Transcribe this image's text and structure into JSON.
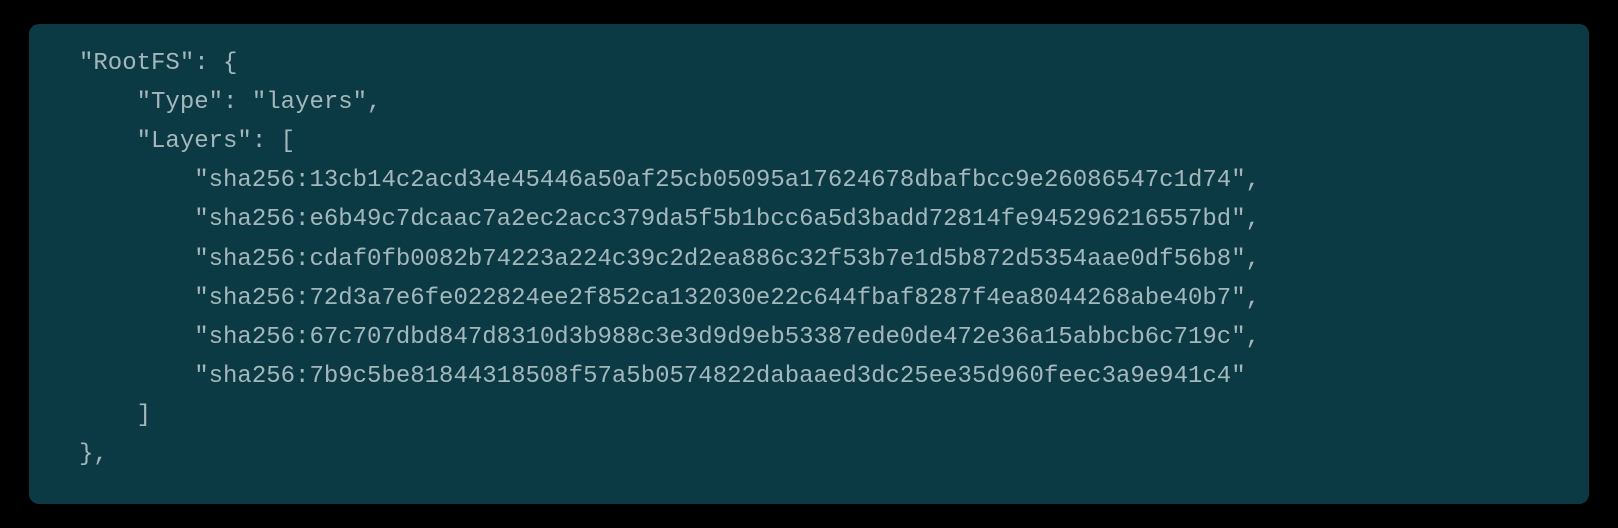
{
  "code": {
    "l0": "\"RootFS\": {",
    "l1": "    \"Type\": \"layers\",",
    "l2": "    \"Layers\": [",
    "l3": "        \"sha256:13cb14c2acd34e45446a50af25cb05095a17624678dbafbcc9e26086547c1d74\",",
    "l4": "        \"sha256:e6b49c7dcaac7a2ec2acc379da5f5b1bcc6a5d3badd72814fe945296216557bd\",",
    "l5": "        \"sha256:cdaf0fb0082b74223a224c39c2d2ea886c32f53b7e1d5b872d5354aae0df56b8\",",
    "l6": "        \"sha256:72d3a7e6fe022824ee2f852ca132030e22c644fbaf8287f4ea8044268abe40b7\",",
    "l7": "        \"sha256:67c707dbd847d8310d3b988c3e3d9d9eb53387ede0de472e36a15abbcb6c719c\",",
    "l8": "        \"sha256:7b9c5be81844318508f57a5b0574822dabaaed3dc25ee35d960feec3a9e941c4\"",
    "l9": "    ]",
    "l10": "},"
  }
}
